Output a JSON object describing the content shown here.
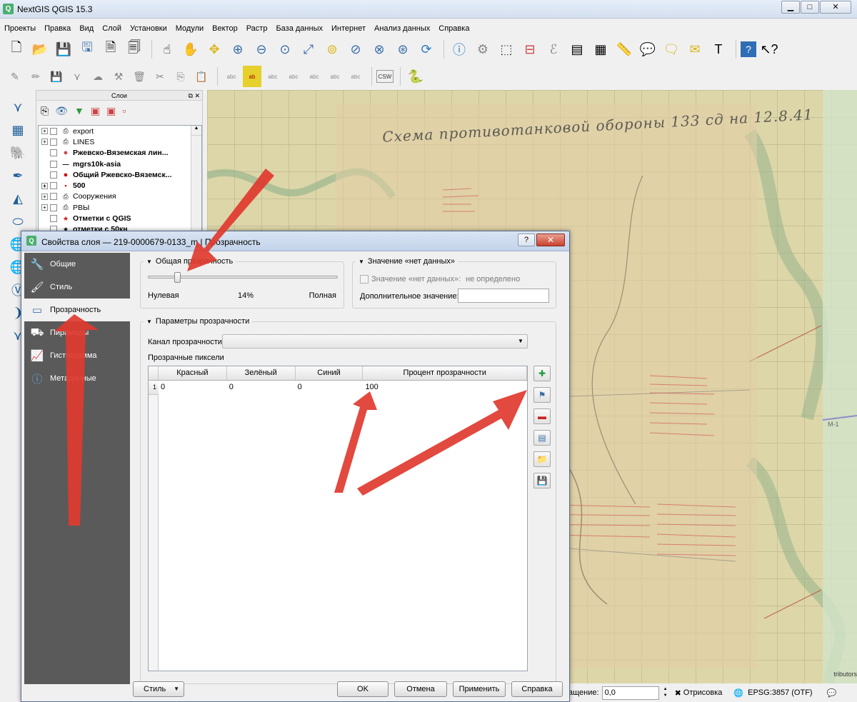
{
  "app": {
    "title": "NextGIS QGIS 15.3"
  },
  "window_buttons": {
    "minimize": "▁",
    "maximize": "□",
    "close": "✕"
  },
  "menu": [
    "Проекты",
    "Правка",
    "Вид",
    "Слой",
    "Установки",
    "Модули",
    "Вектор",
    "Растр",
    "База данных",
    "Интернет",
    "Анализ данных",
    "Справка"
  ],
  "toolbar1": {
    "icons": [
      "new-project-icon",
      "open-project-icon",
      "save-project-icon",
      "save-as-icon",
      "new-print-composer-icon",
      "composer-manager-icon",
      "touch-zoom-icon",
      "pan-icon",
      "pan-to-selection-icon",
      "zoom-in-icon",
      "zoom-out-icon",
      "zoom-native-icon",
      "zoom-full-icon",
      "zoom-to-selection-icon",
      "zoom-to-layer-icon",
      "zoom-last-icon",
      "zoom-next-icon",
      "refresh-icon",
      "identify-icon",
      "action-icon",
      "select-icon",
      "deselect-icon",
      "expression-icon",
      "attribute-table-icon",
      "field-calculator-icon",
      "measure-icon",
      "annotation-icon",
      "tips-icon",
      "bookmark-icon",
      "text-annotation-icon",
      "help-icon",
      "whats-this-icon"
    ]
  },
  "toolbar2": {
    "icons": [
      "edits-icon",
      "toggle-editing-icon",
      "save-edits-icon",
      "add-feature-icon",
      "move-feature-icon",
      "node-tool-icon",
      "delete-selected-icon",
      "cut-features-icon",
      "copy-features-icon",
      "paste-features-icon",
      "label-icon",
      "highlight-label-icon",
      "pin-label-icon",
      "show-hide-label-icon",
      "move-label-icon",
      "rotate-label-icon",
      "change-label-icon",
      "csw-icon",
      "python-icon"
    ],
    "csw_label": "CSW"
  },
  "left_toolbar": {
    "icons": [
      "add-vector-layer-icon",
      "add-raster-layer-icon",
      "add-postgis-layer-icon",
      "add-spatialite-layer-icon",
      "add-mssql-layer-icon",
      "add-oracle-layer-icon",
      "add-wms-layer-icon",
      "add-wcs-layer-icon",
      "add-wfs-layer-icon",
      "add-delimited-text-icon",
      "add-virtual-layer-icon"
    ]
  },
  "layers_panel": {
    "title": "Слои",
    "items": [
      {
        "label": "export",
        "expand": "+",
        "kind": "group",
        "bold": false
      },
      {
        "label": "LINES",
        "expand": "+",
        "kind": "group",
        "bold": false
      },
      {
        "label": "Ржевско-Вяземская лин...",
        "expand": "",
        "kind": "circle",
        "color": "#c94a4a",
        "bold": true
      },
      {
        "label": "mgrs10k-asia",
        "expand": "",
        "kind": "line",
        "bold": true
      },
      {
        "label": "Общий Ржевско-Вяземск...",
        "expand": "",
        "kind": "circle",
        "color": "#cc1010",
        "bold": true
      },
      {
        "label": "500",
        "expand": "+",
        "kind": "dot",
        "color": "#cc1010",
        "bold": true
      },
      {
        "label": "Сооружения",
        "expand": "+",
        "kind": "group",
        "bold": false
      },
      {
        "label": "РВЫ",
        "expand": "+",
        "kind": "group",
        "bold": false
      },
      {
        "label": "Отметки с QGIS",
        "expand": "",
        "kind": "star",
        "color": "#cc1010",
        "bold": true
      },
      {
        "label": "отметки с 50кн",
        "expand": "",
        "kind": "star",
        "color": "#000000",
        "bold": true
      }
    ]
  },
  "map": {
    "scan_title": "Схема противотанковой обороны 133 сд на 12.8.41",
    "road_label": "M-1",
    "attribution": "tributors"
  },
  "statusbar": {
    "rotation_label": "ащение:",
    "rotation_value": "0,0",
    "render_label": "Отрисовка",
    "render_checked": "✖",
    "crs_label": "EPSG:3857 (OTF)"
  },
  "dialog": {
    "title": "Свойства слоя — 219-0000679-0133_m | Прозрачность",
    "help_btn": "?",
    "close_btn": "✕",
    "nav": [
      {
        "label": "Общие",
        "icon": "wrench-icon",
        "selected": false
      },
      {
        "label": "Стиль",
        "icon": "brush-icon",
        "selected": false
      },
      {
        "label": "Прозрачность",
        "icon": "transparency-icon",
        "selected": true
      },
      {
        "label": "Пирамиды",
        "icon": "pyramids-icon",
        "selected": false
      },
      {
        "label": "Гистограмма",
        "icon": "histogram-icon",
        "selected": false
      },
      {
        "label": "Метаданные",
        "icon": "info-icon",
        "selected": false
      }
    ],
    "global_transparency": {
      "title": "Общая прозрачность",
      "min_label": "Нулевая",
      "value_label": "14%",
      "value_percent": 14,
      "max_label": "Полная"
    },
    "nodata": {
      "title": "Значение «нет данных»",
      "checkbox_label": "Значение «нет данных»:",
      "value": "не определено",
      "additional_label": "Дополнительное значение:",
      "additional_value": ""
    },
    "params": {
      "title": "Параметры прозрачности",
      "channel_label": "Канал прозрачности",
      "channel_value": "",
      "pixels_label": "Прозрачные пиксели",
      "columns": [
        "Красный",
        "Зелёный",
        "Синий",
        "Процент прозрачности"
      ],
      "rows": [
        {
          "num": "1",
          "r": "0",
          "g": "0",
          "b": "0",
          "pct": "100"
        }
      ]
    },
    "side_buttons": [
      "add-value-icon",
      "add-from-display-icon",
      "remove-value-icon",
      "default-values-icon",
      "import-file-icon",
      "export-file-icon"
    ],
    "buttons": {
      "style": "Стиль",
      "ok": "OK",
      "cancel": "Отмена",
      "apply": "Применить",
      "help": "Справка"
    }
  },
  "colors": {
    "arrow": "#e03a2f",
    "nav_bg": "#5a5a5a",
    "dialog_title": "#c9d8ec"
  }
}
